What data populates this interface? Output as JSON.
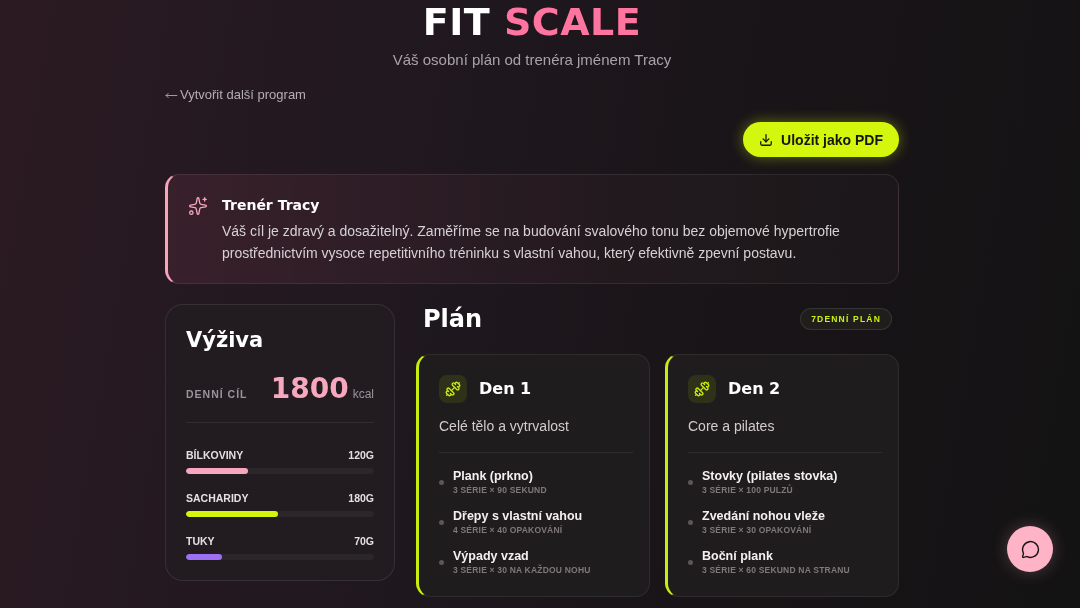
{
  "header": {
    "logo": {
      "first": "FIT",
      "second": "SCALE"
    },
    "subtitle": "Váš osobní plán od trenéra jménem Tracy"
  },
  "back_link": {
    "label": "Vytvořit další program"
  },
  "save_button": {
    "label": "Uložit jako PDF"
  },
  "coach_note": {
    "title": "Trenér Tracy",
    "text": "Váš cíl je zdravý a dosažitelný. Zaměříme se na budování svalového tonu bez objemové hypertrofie prostřednictvím vysoce repetitivního tréninku s vlastní vahou, který efektivně zpevní postavu."
  },
  "nutrition": {
    "title": "Výživa",
    "goal_label": "DENNÍ CÍL",
    "goal_value": "1800",
    "goal_unit": "kcal",
    "macros": [
      {
        "name": "BÍLKOVINY",
        "amount": "120G",
        "level": 0.33,
        "color": "#f7a7bd"
      },
      {
        "name": "SACHARIDY",
        "amount": "180G",
        "level": 0.49,
        "color": "#d4f50c"
      },
      {
        "name": "TUKY",
        "amount": "70G",
        "level": 0.19,
        "color": "#9d6ff2"
      }
    ]
  },
  "plan": {
    "title": "Plán",
    "badge": "7DENNÍ PLÁN",
    "days": [
      {
        "title": "Den 1",
        "focus": "Celé tělo a vytrvalost",
        "exercises": [
          {
            "name": "Plank (prkno)",
            "detail": "3 SÉRIE × 90 SEKUND"
          },
          {
            "name": "Dřepy s vlastní vahou",
            "detail": "4 SÉRIE × 40 OPAKOVÁNÍ"
          },
          {
            "name": "Výpady vzad",
            "detail": "3 SÉRIE × 30 NA KAŽDOU NOHU"
          }
        ]
      },
      {
        "title": "Den 2",
        "focus": "Core a pilates",
        "exercises": [
          {
            "name": "Stovky (pilates stovka)",
            "detail": "3 SÉRIE × 100 PULZŮ"
          },
          {
            "name": "Zvedání nohou vleže",
            "detail": "3 SÉRIE × 30 OPAKOVÁNÍ"
          },
          {
            "name": "Boční plank",
            "detail": "3 SÉRIE × 60 SEKUND NA STRANU"
          }
        ]
      }
    ]
  }
}
